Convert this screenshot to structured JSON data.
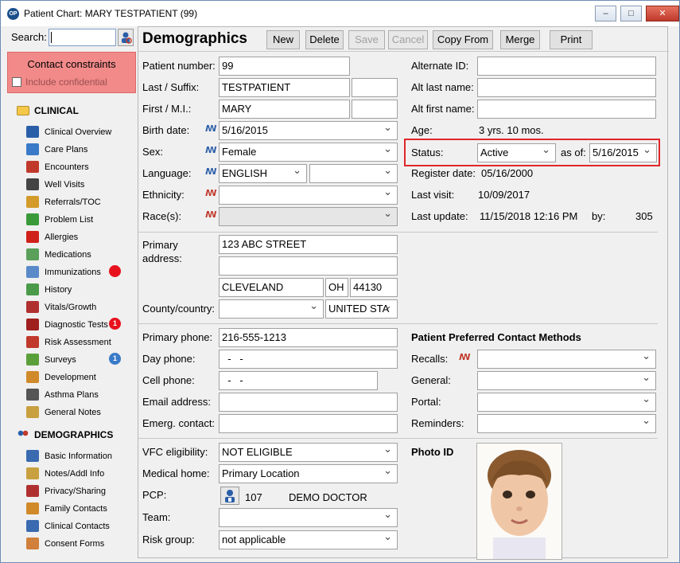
{
  "window": {
    "title": "Patient Chart: MARY TESTPATIENT (99)",
    "minimize": "‒",
    "maximize": "□",
    "close": "✕"
  },
  "sidebar": {
    "search_label": "Search:",
    "contact_constraints": "Contact constraints",
    "include_confidential": "Include confidential",
    "clinical_header": "CLINICAL",
    "clinical_items": [
      {
        "label": "Clinical Overview",
        "icon": "clinical-overview-icon",
        "color": "#2b5ea8"
      },
      {
        "label": "Care Plans",
        "icon": "care-plans-icon",
        "color": "#3a7ac8"
      },
      {
        "label": "Encounters",
        "icon": "encounters-icon",
        "color": "#c0392b"
      },
      {
        "label": "Well Visits",
        "icon": "stethoscope-icon",
        "color": "#444444"
      },
      {
        "label": "Referrals/TOC",
        "icon": "referrals-icon",
        "color": "#d49a2a"
      },
      {
        "label": "Problem List",
        "icon": "problem-list-icon",
        "color": "#3a9a3a"
      },
      {
        "label": "Allergies",
        "icon": "allergies-icon",
        "color": "#d0201a"
      },
      {
        "label": "Medications",
        "icon": "medications-icon",
        "color": "#5aa05a"
      },
      {
        "label": "Immunizations",
        "icon": "syringe-icon",
        "color": "#5a8ac8"
      },
      {
        "label": "History",
        "icon": "history-icon",
        "color": "#4a9a4a"
      },
      {
        "label": "Vitals/Growth",
        "icon": "vitals-icon",
        "color": "#b03030"
      },
      {
        "label": "Diagnostic Tests",
        "icon": "test-tubes-icon",
        "color": "#a02020"
      },
      {
        "label": "Risk Assessment",
        "icon": "risk-icon",
        "color": "#c0392b"
      },
      {
        "label": "Surveys",
        "icon": "surveys-icon",
        "color": "#5aa03a"
      },
      {
        "label": "Development",
        "icon": "development-icon",
        "color": "#d08a2a"
      },
      {
        "label": "Asthma Plans",
        "icon": "asthma-icon",
        "color": "#555555"
      },
      {
        "label": "General Notes",
        "icon": "notes-icon",
        "color": "#c8a040"
      }
    ],
    "badges": {
      "diagnostic_tests": "1",
      "surveys": "1"
    },
    "demographics_header": "DEMOGRAPHICS",
    "demographics_items": [
      {
        "label": "Basic Information",
        "icon": "id-card-icon",
        "color": "#3a6ab0"
      },
      {
        "label": "Notes/Addl Info",
        "icon": "notes-pen-icon",
        "color": "#c8a040"
      },
      {
        "label": "Privacy/Sharing",
        "icon": "privacy-icon",
        "color": "#b03030"
      },
      {
        "label": "Family Contacts",
        "icon": "family-icon",
        "color": "#d08a2a"
      },
      {
        "label": "Clinical Contacts",
        "icon": "doctor-icon",
        "color": "#3a6ab0"
      },
      {
        "label": "Consent Forms",
        "icon": "consent-icon",
        "color": "#d0803a"
      }
    ]
  },
  "toolbar": {
    "title": "Demographics",
    "new": "New",
    "delete": "Delete",
    "save": "Save",
    "cancel": "Cancel",
    "copy_from": "Copy From",
    "merge": "Merge",
    "print": "Print"
  },
  "form": {
    "patient_number_label": "Patient number:",
    "patient_number": "99",
    "last_suffix_label": "Last / Suffix:",
    "last_name": "TESTPATIENT",
    "suffix": "",
    "first_mi_label": "First / M.I.:",
    "first_name": "MARY",
    "middle_initial": "",
    "birth_date_label": "Birth date:",
    "birth_date": "5/16/2015",
    "sex_label": "Sex:",
    "sex": "Female",
    "language_label": "Language:",
    "language": "ENGLISH",
    "language2": "",
    "ethnicity_label": "Ethnicity:",
    "ethnicity": "",
    "race_label": "Race(s):",
    "race": "",
    "primary_address_label": "Primary address:",
    "address1": "123 ABC STREET",
    "address2": "",
    "city": "CLEVELAND",
    "state": "OH",
    "zip": "44130",
    "county_country_label": "County/country:",
    "county": "",
    "country": "UNITED STA",
    "primary_phone_label": "Primary phone:",
    "primary_phone": "216-555-1213",
    "day_phone_label": "Day phone:",
    "day_phone": "  -   -",
    "cell_phone_label": "Cell phone:",
    "cell_phone": "  -   -",
    "email_label": "Email address:",
    "email": "",
    "emerg_contact_label": "Emerg. contact:",
    "emerg_contact": "",
    "vfc_label": "VFC eligibility:",
    "vfc": "NOT ELIGIBLE",
    "medical_home_label": "Medical home:",
    "medical_home": "Primary Location",
    "pcp_label": "PCP:",
    "pcp_id": "107",
    "pcp_name": "DEMO DOCTOR",
    "team_label": "Team:",
    "team": "",
    "risk_group_label": "Risk group:",
    "risk_group": "not applicable"
  },
  "right": {
    "alternate_id_label": "Alternate ID:",
    "alternate_id": "",
    "alt_last_label": "Alt last name:",
    "alt_last": "",
    "alt_first_label": "Alt first name:",
    "alt_first": "",
    "age_label": "Age:",
    "age": "3 yrs. 10 mos.",
    "status_label": "Status:",
    "status": "Active",
    "as_of_label": "as of:",
    "as_of": "5/16/2015",
    "register_date_label": "Register date:",
    "register_date": "05/16/2000",
    "last_visit_label": "Last visit:",
    "last_visit": "10/09/2017",
    "last_update_label": "Last update:",
    "last_update": "11/15/2018 12:16 PM",
    "by_label": "by:",
    "by": "305",
    "contact_methods_title": "Patient Preferred Contact Methods",
    "recalls_label": "Recalls:",
    "recalls": "",
    "general_label": "General:",
    "general": "",
    "portal_label": "Portal:",
    "portal": "",
    "reminders_label": "Reminders:",
    "reminders": "",
    "photo_id_label": "Photo ID"
  },
  "flag_glyph": "ꟿ",
  "colors": {
    "accent": "#2b5ea8",
    "alert": "#e0262b",
    "constraint_bg": "#f28a8a"
  }
}
